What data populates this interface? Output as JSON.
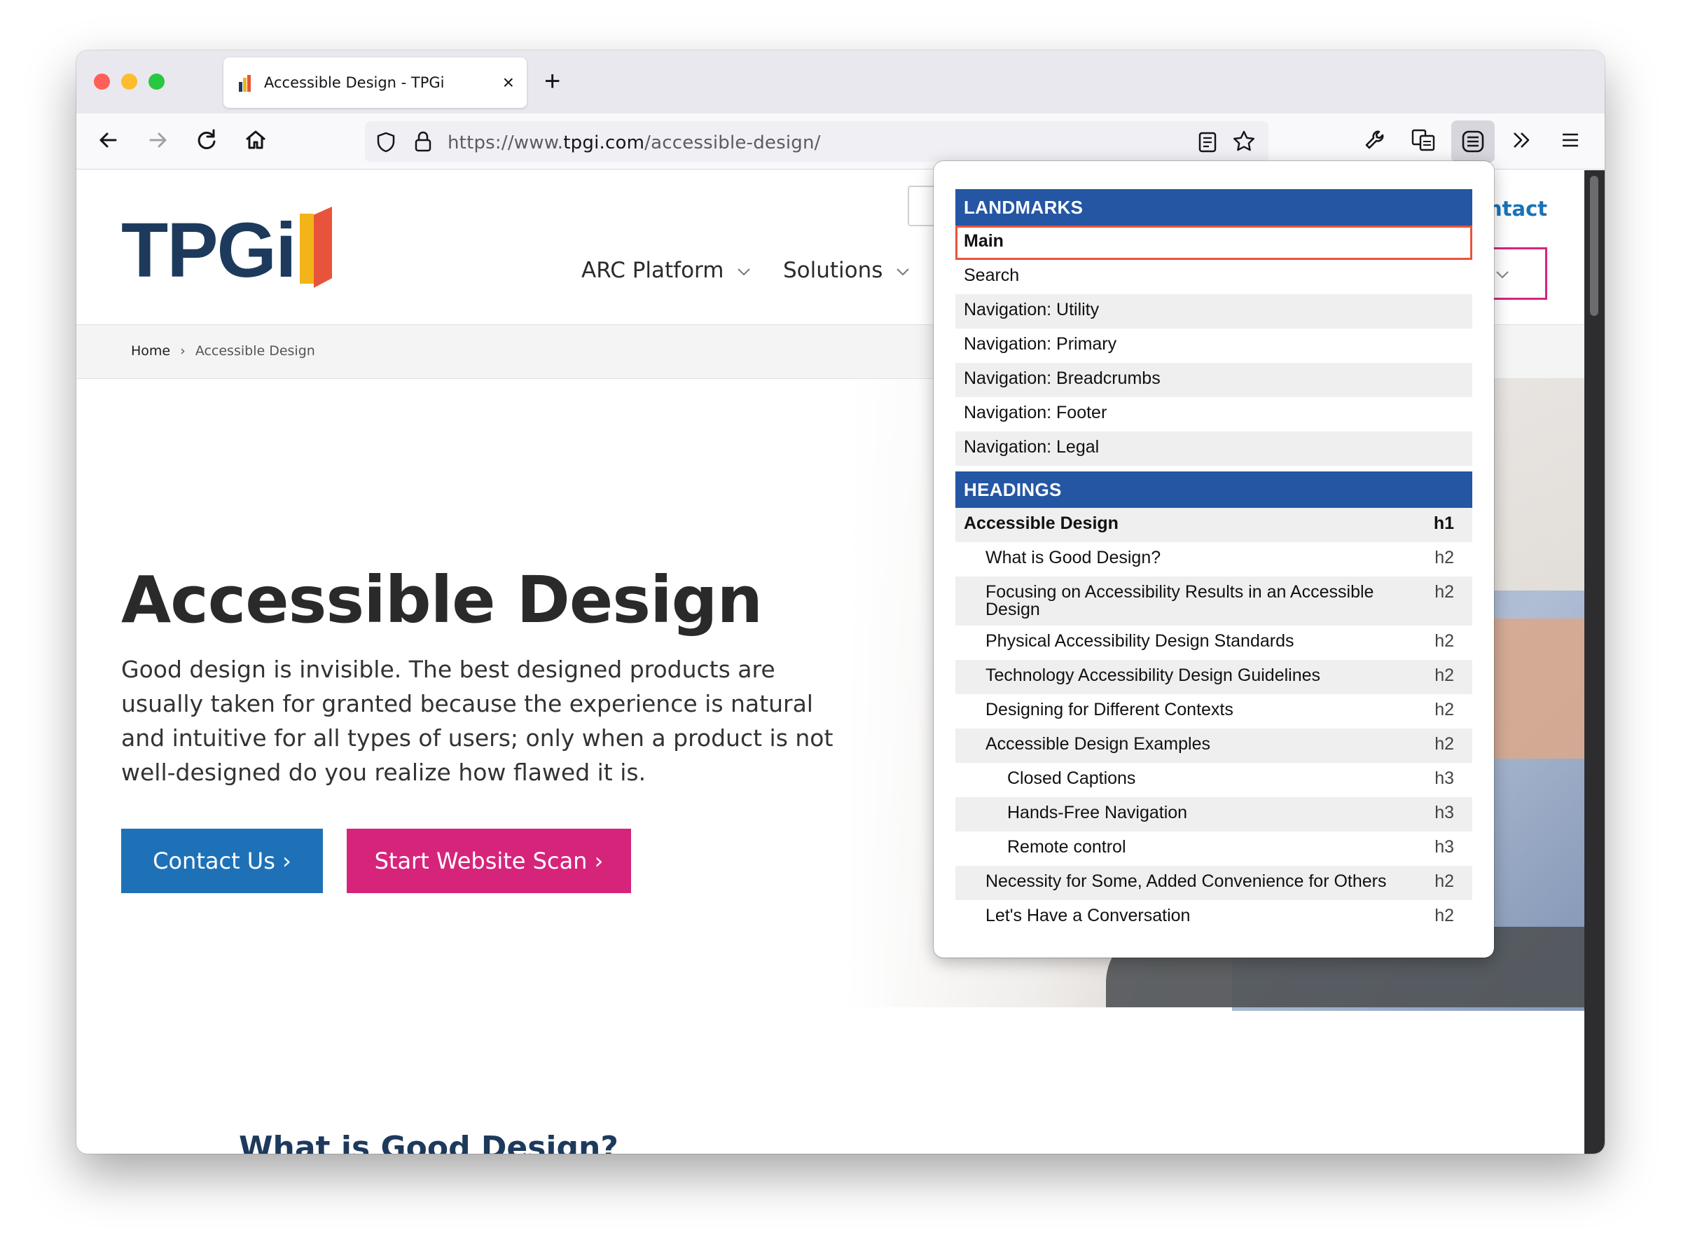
{
  "browser": {
    "tab": {
      "title": "Accessible Design - TPGi",
      "close_glyph": "×"
    },
    "new_tab_glyph": "+",
    "url": {
      "prefix": "https://www.",
      "domain": "tpgi.com",
      "path": "/accessible-design/"
    },
    "icons": [
      "back-arrow-icon",
      "forward-arrow-icon",
      "reload-icon",
      "home-icon",
      "shield-icon",
      "lock-icon",
      "reader-view-icon",
      "bookmark-star-icon",
      "wrench-icon",
      "translate-icon",
      "landmarks-extension-icon",
      "overflow-chevrons-icon",
      "hamburger-menu-icon"
    ]
  },
  "site": {
    "logo": "TPGi",
    "nav": {
      "arc_platform": "ARC Platform",
      "solutions": "Solutions",
      "contact_partial": "ntact"
    },
    "breadcrumb": {
      "home": "Home",
      "separator": "›",
      "current": "Accessible Design"
    },
    "hero": {
      "title": "Accessible Design",
      "text": "Good design is invisible. The best designed products are usually taken for granted because the experience is natural and intuitive for all types of users; only when a product is not well-designed do you realize how flawed it is.",
      "contact_button": "Contact Us  ›",
      "scan_button": "Start Website Scan  ›"
    },
    "section_heading": "What is Good Design?",
    "colors": {
      "navy": "#1d3a5c",
      "blue": "#1f71b7",
      "pink": "#d6247b"
    }
  },
  "popup": {
    "landmarks_header": "LANDMARKS",
    "landmarks": [
      {
        "label": "Main",
        "selected": true
      },
      {
        "label": "Search"
      },
      {
        "label": "Navigation: Utility"
      },
      {
        "label": "Navigation: Primary"
      },
      {
        "label": "Navigation: Breadcrumbs"
      },
      {
        "label": "Navigation: Footer"
      },
      {
        "label": "Navigation: Legal"
      }
    ],
    "headings_header": "HEADINGS",
    "headings": [
      {
        "label": "Accessible Design",
        "level": "h1"
      },
      {
        "label": "What is Good Design?",
        "level": "h2"
      },
      {
        "label": "Focusing on Accessibility Results in an Accessible Design",
        "level": "h2"
      },
      {
        "label": "Physical Accessibility Design Standards",
        "level": "h2"
      },
      {
        "label": "Technology Accessibility Design Guidelines",
        "level": "h2"
      },
      {
        "label": "Designing for Different Contexts",
        "level": "h2"
      },
      {
        "label": "Accessible Design Examples",
        "level": "h2"
      },
      {
        "label": "Closed Captions",
        "level": "h3"
      },
      {
        "label": "Hands-Free Navigation",
        "level": "h3"
      },
      {
        "label": "Remote control",
        "level": "h3"
      },
      {
        "label": "Necessity for Some, Added Convenience for Others",
        "level": "h2"
      },
      {
        "label": "Let's Have a Conversation",
        "level": "h2"
      }
    ],
    "header_color": "#2456a4",
    "selection_color": "#e8543b"
  }
}
